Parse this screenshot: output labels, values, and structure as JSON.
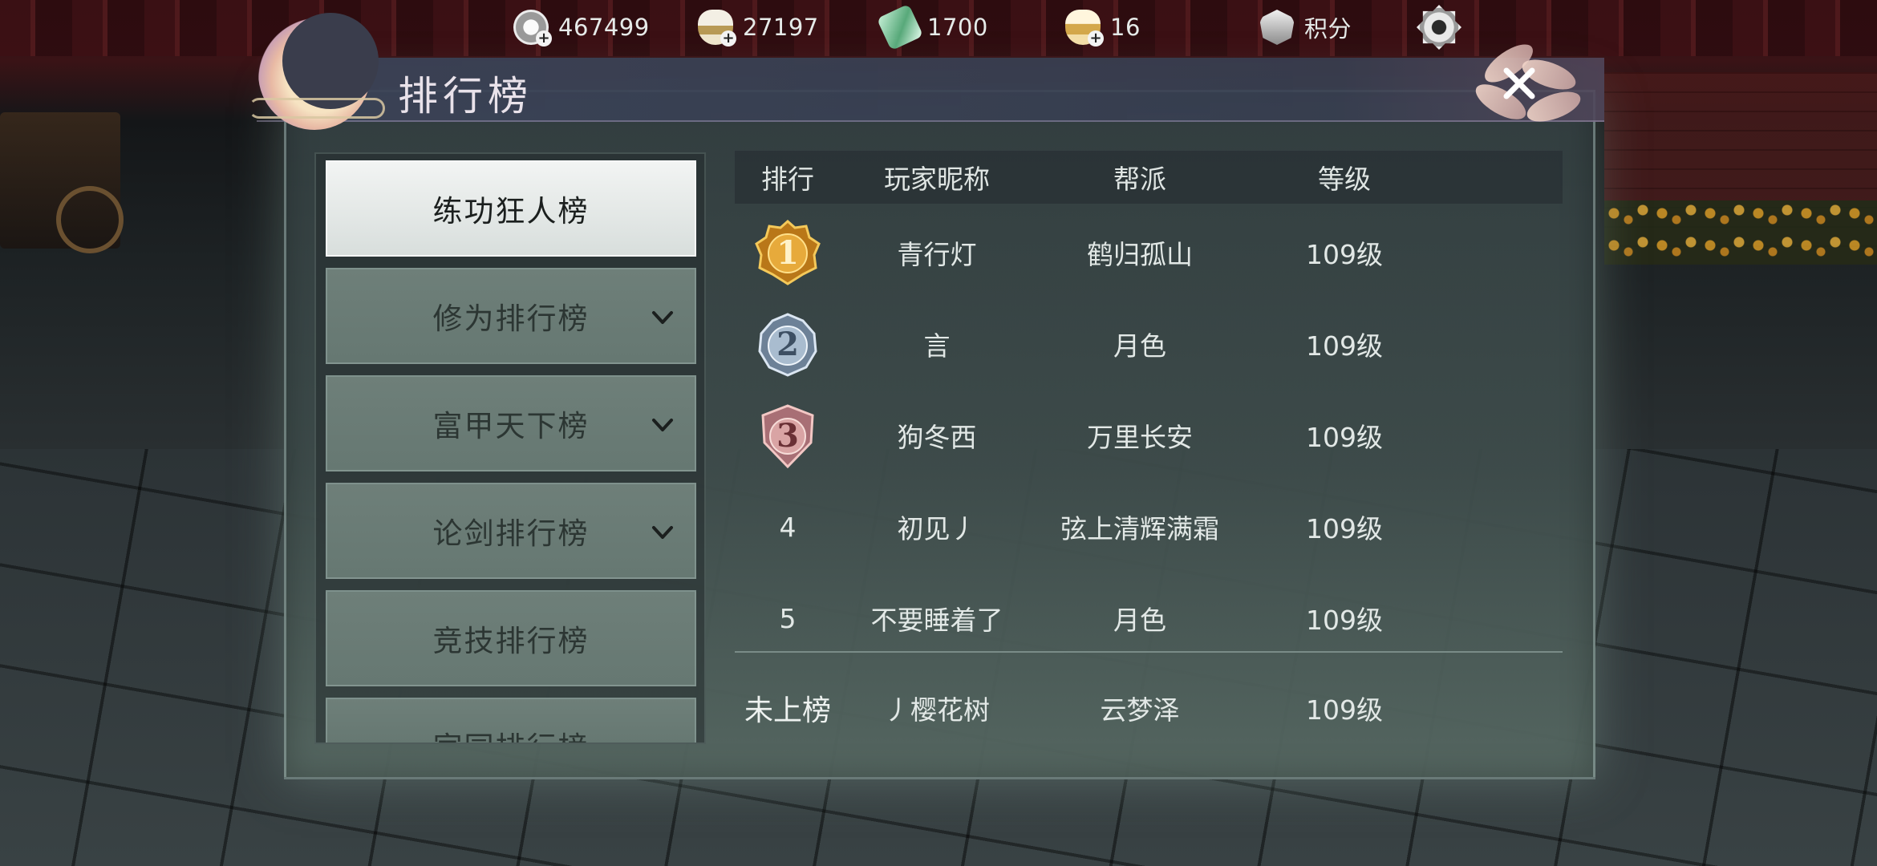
{
  "topbar": {
    "currencies": [
      {
        "icon": "silver-coin-icon",
        "value": "467499"
      },
      {
        "icon": "silver-ingot-icon",
        "value": "27197"
      },
      {
        "icon": "jade-icon",
        "value": "1700"
      },
      {
        "icon": "gold-ingot-icon",
        "value": "16"
      }
    ],
    "points": {
      "icon": "shield-points-icon",
      "label": "积分"
    }
  },
  "panel": {
    "title": "排行榜"
  },
  "categories": [
    {
      "label": "练功狂人榜",
      "active": true,
      "expandable": false
    },
    {
      "label": "修为排行榜",
      "active": false,
      "expandable": true
    },
    {
      "label": "富甲天下榜",
      "active": false,
      "expandable": true
    },
    {
      "label": "论剑排行榜",
      "active": false,
      "expandable": true
    },
    {
      "label": "竞技排行榜",
      "active": false,
      "expandable": false
    },
    {
      "label": "家园排行榜",
      "active": false,
      "expandable": false
    }
  ],
  "table": {
    "headers": [
      "排行",
      "玩家昵称",
      "帮派",
      "等级"
    ],
    "rows": [
      {
        "rank": "1",
        "medal": "gold",
        "name": "青行灯",
        "guild": "鹤归孤山",
        "level": "109级"
      },
      {
        "rank": "2",
        "medal": "silver",
        "name": "言",
        "guild": "月色",
        "level": "109级"
      },
      {
        "rank": "3",
        "medal": "bronze",
        "name": "狗冬西",
        "guild": "万里长安",
        "level": "109级"
      },
      {
        "rank": "4",
        "medal": "",
        "name": "初见丿",
        "guild": "弦上清辉满霜",
        "level": "109级"
      },
      {
        "rank": "5",
        "medal": "",
        "name": "不要睡着了",
        "guild": "月色",
        "level": "109级"
      }
    ],
    "self": {
      "rank": "未上榜",
      "name": "丿樱花树",
      "guild": "云梦泽",
      "level": "109级"
    }
  },
  "colors": {
    "gold_medal": "#e0a23a",
    "silver_medal": "#9fb2c6",
    "bronze_medal": "#d9a0a0",
    "active_tab": "#eef1f0"
  }
}
